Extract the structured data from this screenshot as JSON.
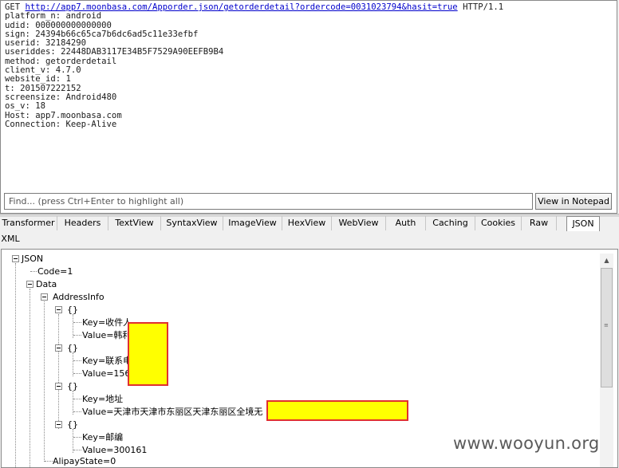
{
  "request": {
    "method": "GET",
    "url": "http://app7.moonbasa.com/Apporder.json/getorderdetail?ordercode=0031023794&hasit=true",
    "protocol": "HTTP/1.1",
    "headers": [
      "platform_n: android",
      "udid: 000000000000000",
      "sign: 24394b66c65ca7b6dc6ad5c11e33efbf",
      "userid: 32184290",
      "useriddes: 22448DAB3117E34B5F7529A90EEFB9B4",
      "method: getorderdetail",
      "client_v: 4.7.0",
      "website_id: 1",
      "t: 201507222152",
      "screensize: Android480",
      "os_v: 18",
      "Host: app7.moonbasa.com",
      "Connection: Keep-Alive"
    ]
  },
  "find": {
    "placeholder": "Find... (press Ctrl+Enter to highlight all)"
  },
  "notepad_button": "View in Notepad",
  "tabs": [
    "Transformer",
    "Headers",
    "TextView",
    "SyntaxView",
    "ImageView",
    "HexView",
    "WebView",
    "Auth",
    "Caching",
    "Cookies",
    "Raw",
    "JSON"
  ],
  "active_tab": "JSON",
  "xml_tab": "XML",
  "tree": {
    "root": "JSON",
    "code": "Code=1",
    "data": "Data",
    "address_info": "AddressInfo",
    "brace": "{}",
    "items": [
      {
        "key": "Key=收件人",
        "value": "Value=韩利"
      },
      {
        "key": "Key=联系电",
        "value": "Value=1569"
      },
      {
        "key": "Key=地址",
        "value": "Value=天津市天津市东丽区天津东丽区全境无"
      },
      {
        "key": "Key=邮编",
        "value": "Value=300161"
      }
    ],
    "alipay": "AlipayState=0"
  },
  "watermark": "www.wooyun.org"
}
